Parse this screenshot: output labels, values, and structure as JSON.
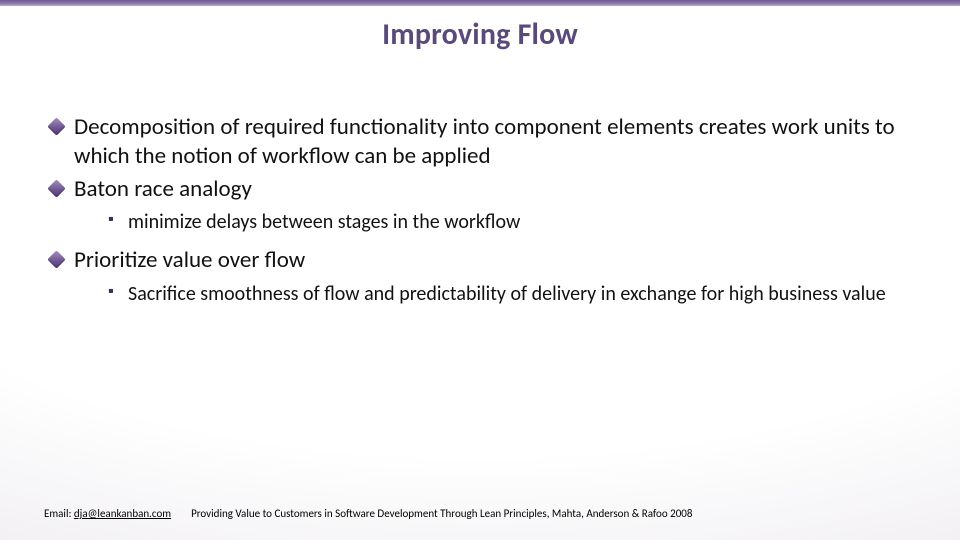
{
  "title": "Improving Flow",
  "bullets": {
    "b1": "Decomposition of required functionality into component elements creates work units to which the notion of workflow can be applied",
    "b2": "Baton race analogy",
    "b2_sub1": "minimize delays between stages in the workflow",
    "b3": "Prioritize value over flow",
    "b3_sub1": "Sacrifice smoothness of flow and predictability of delivery in exchange for high business value"
  },
  "footer": {
    "email_label": "Email: ",
    "email_link_text": "dja@leankanban.com",
    "citation": "Providing Value to Customers in Software Development Through Lean Principles, Mahta, Anderson & Rafoo 2008"
  }
}
